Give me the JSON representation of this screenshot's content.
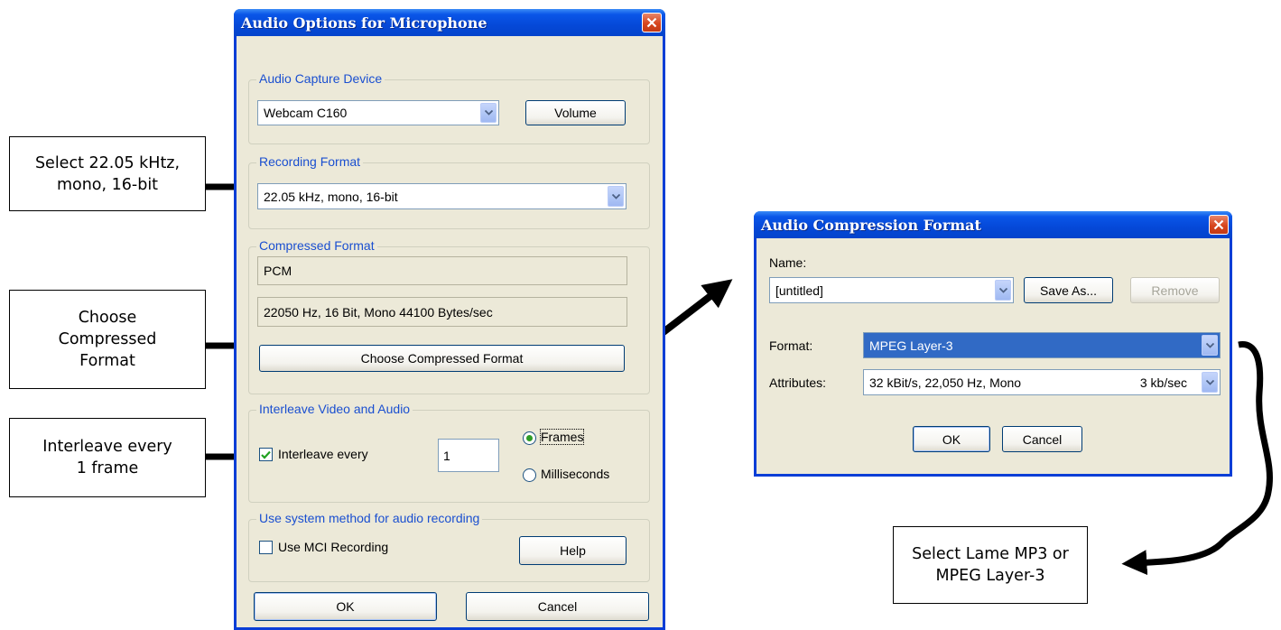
{
  "callouts": {
    "recording_format": [
      "Select 22.05 kHtz,",
      "mono, 16-bit"
    ],
    "compressed_format": [
      "Choose",
      "Compressed",
      "Format"
    ],
    "interleave": [
      "Interleave every",
      "1 frame"
    ],
    "lame": [
      "Select Lame MP3 or",
      "MPEG Layer-3"
    ]
  },
  "audio_options": {
    "title": "Audio Options for Microphone",
    "capture_device": {
      "legend": "Audio Capture Device",
      "device": "Webcam C160",
      "volume_button": "Volume"
    },
    "recording_format": {
      "legend": "Recording Format",
      "value": "22.05 kHz, mono, 16-bit"
    },
    "compressed_format": {
      "legend": "Compressed Format",
      "name": "PCM",
      "details": "22050 Hz, 16 Bit, Mono 44100 Bytes/sec",
      "choose_button": "Choose  Compressed Format"
    },
    "interleave": {
      "legend": "Interleave Video and Audio",
      "checkbox_label": "Interleave every",
      "checked": true,
      "value": "1",
      "radio_frames": "Frames",
      "radio_ms": "Milliseconds",
      "selected": "Frames"
    },
    "system_method": {
      "legend": "Use system method for audio recording",
      "checkbox_label": "Use MCI Recording",
      "checked": false,
      "help_button": "Help"
    },
    "ok_button": "OK",
    "cancel_button": "Cancel"
  },
  "compression_format": {
    "title": "Audio Compression Format",
    "name_label": "Name:",
    "name_value": "[untitled]",
    "save_as_button": "Save As...",
    "remove_button": "Remove",
    "format_label": "Format:",
    "format_value": "MPEG Layer-3",
    "attributes_label": "Attributes:",
    "attributes_value": "32 kBit/s, 22,050 Hz, Mono",
    "attributes_rate": "3 kb/sec",
    "ok_button": "OK",
    "cancel_button": "Cancel"
  },
  "colors": {
    "title_bar": "#0a56e8",
    "window_face": "#ece9d8",
    "group_legend": "#1a4fd0",
    "selection": "#316ac5",
    "close_button": "#d7461e"
  }
}
